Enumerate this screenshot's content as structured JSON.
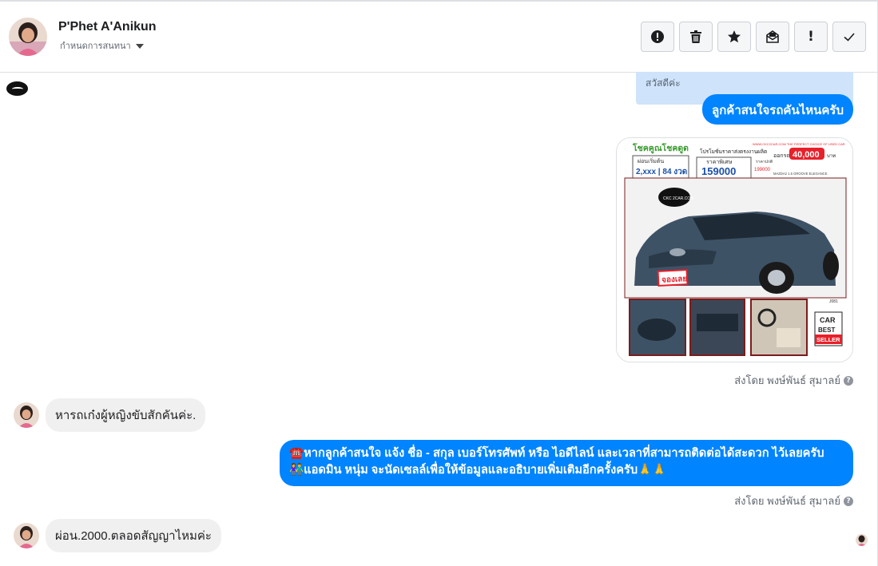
{
  "header": {
    "contact_name": "P'Phet A'Anikun",
    "subtitle": "กำหนดการสนทนา",
    "toolbar": [
      {
        "name": "report-icon"
      },
      {
        "name": "trash-icon"
      },
      {
        "name": "star-icon"
      },
      {
        "name": "mark-unread-icon"
      },
      {
        "name": "important-icon",
        "glyph": "!"
      },
      {
        "name": "done-icon"
      }
    ]
  },
  "messages": {
    "greeting": "สวัสดีค่ะ",
    "out_1": "ลูกค้าสนใจรถคันไหนครับ",
    "sent_by_1": "ส่งโดย พงษ์พันธ์ สุมาลย์",
    "in_1": "หารถเก๋งผู้หญิงขับสักคันค่ะ.",
    "out_2_line1": "☎️หากลูกค้าสนใจ แจ้ง ชื่อ - สกุล เบอร์โทรศัพท์ หรือ ไอดีไลน์ และเวลาที่สามารถติดต่อได้สะดวก ไว้เลยครับ",
    "out_2_line2": "👫แอดมิน หนุ่ม จะนัดเซลล์เพื่อให้ข้อมูลและอธิบายเพิ่มเติมอีกครั้งครับ🙏🙏",
    "sent_by_2": "ส่งโดย พงษ์พันธ์ สุมาลย์",
    "in_2": "ผ่อน.2000.ตลอดสัญญาไหมค่ะ"
  },
  "car_ad": {
    "headline": "โชคคูณโชคดูด",
    "site": "WWW.CKC2CAR.COM THE PERFECT CHOICE OF USED CAR",
    "promo": "โปรโมชั่นราคาส่งตรงงานผลิต",
    "down_label": "ออกรถ",
    "down_value": "40,000",
    "down_unit": "บาท",
    "installment_label": "ผ่อนเริ่มต้น",
    "installment_value": "2,xxx | 84 งวด",
    "price_label": "ราคาพิเศษ",
    "price_value": "159000",
    "old_price_label": "ราคาปกติ",
    "old_price_value": "199000",
    "model": "MAZDA2 1.5 GROOVE ELEGANCE",
    "stamp": "จองเลย",
    "badge_top": "CAR",
    "badge_mid": "BEST",
    "badge_bottom": "SELLER",
    "code": "J081",
    "logo_text": "CKC 2CAR.COM",
    "colors": {
      "accent": "#e8202a",
      "blue": "#1b4fa8",
      "car_body": "#3e5266"
    }
  },
  "colors": {
    "messenger_blue": "#0084ff",
    "incoming_bg": "#f1f0f0",
    "greeting_bg": "#cfe3fb"
  }
}
